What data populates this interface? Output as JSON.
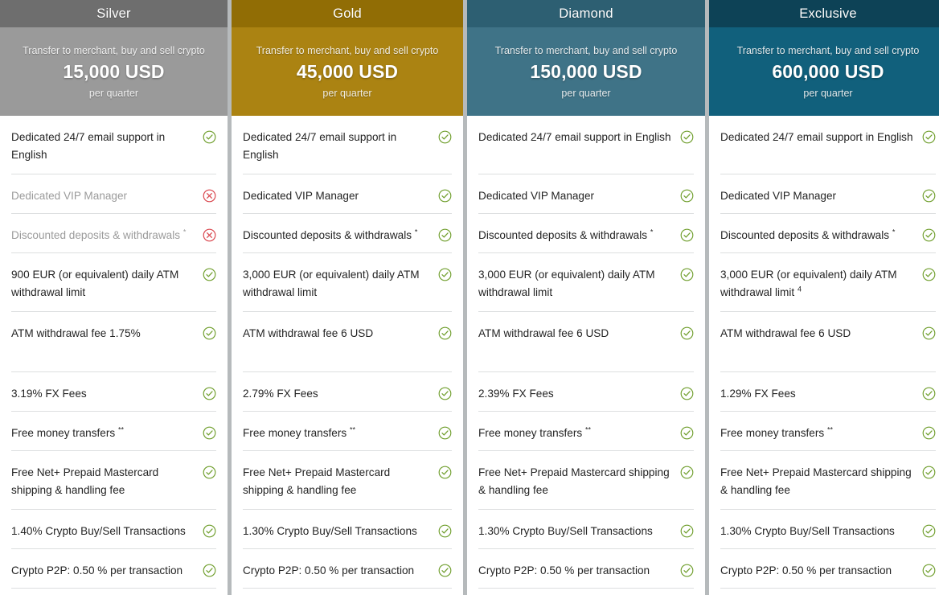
{
  "comparison_table": {
    "price_caption": "Transfer to merchant, buy and sell crypto",
    "price_period": "per quarter",
    "icons": {
      "included": "check-circle-icon",
      "excluded": "x-circle-icon"
    },
    "colors": {
      "silver_header": "#6e6e6e",
      "silver_body": "#9a9a9a",
      "gold_header": "#916d05",
      "gold_body": "#ab8312",
      "diamond_header": "#2d5f72",
      "diamond_body": "#3f7387",
      "exclusive_header": "#0d4256",
      "exclusive_body": "#11607c",
      "check_green": "#6f9e2c",
      "cross_red": "#d9434b",
      "row_divider": "#dddfe0",
      "column_gap": "#b6babc"
    },
    "tiers": [
      {
        "name": "Silver",
        "price": "15,000 USD",
        "features": [
          {
            "text": "Dedicated 24/7 email support in English",
            "sup": "",
            "included": true,
            "size": "tall"
          },
          {
            "text": "Dedicated VIP Manager",
            "sup": "",
            "included": false,
            "size": "normal"
          },
          {
            "text": "Discounted deposits & withdrawals",
            "sup": "*",
            "included": false,
            "size": "normal"
          },
          {
            "text": "900 EUR (or equivalent) daily ATM withdrawal limit",
            "sup": "",
            "included": true,
            "size": "tall"
          },
          {
            "text": "ATM withdrawal fee 1.75%",
            "sup": "",
            "included": true,
            "size": "xtall"
          },
          {
            "text": "3.19% FX Fees",
            "sup": "",
            "included": true,
            "size": "normal"
          },
          {
            "text": "Free money transfers",
            "sup": "**",
            "included": true,
            "size": "normal"
          },
          {
            "text": "Free Net+ Prepaid Mastercard shipping & handling fee",
            "sup": "",
            "included": true,
            "size": "tall"
          },
          {
            "text": "1.40% Crypto Buy/Sell Transactions",
            "sup": "",
            "included": true,
            "size": "normal"
          },
          {
            "text": "Crypto P2P: 0.50 % per transaction",
            "sup": "",
            "included": true,
            "size": "normal"
          }
        ]
      },
      {
        "name": "Gold",
        "price": "45,000 USD",
        "features": [
          {
            "text": "Dedicated 24/7 email support in English",
            "sup": "",
            "included": true,
            "size": "tall"
          },
          {
            "text": "Dedicated VIP Manager",
            "sup": "",
            "included": true,
            "size": "normal"
          },
          {
            "text": "Discounted deposits & withdrawals",
            "sup": "*",
            "included": true,
            "size": "normal"
          },
          {
            "text": "3,000 EUR (or equivalent) daily ATM withdrawal limit",
            "sup": "",
            "included": true,
            "size": "tall"
          },
          {
            "text": "ATM withdrawal fee 6 USD",
            "sup": "",
            "included": true,
            "size": "xtall"
          },
          {
            "text": "2.79% FX Fees",
            "sup": "",
            "included": true,
            "size": "normal"
          },
          {
            "text": "Free money transfers",
            "sup": "**",
            "included": true,
            "size": "normal"
          },
          {
            "text": "Free Net+ Prepaid Mastercard shipping & handling fee",
            "sup": "",
            "included": true,
            "size": "tall"
          },
          {
            "text": "1.30% Crypto Buy/Sell Transactions",
            "sup": "",
            "included": true,
            "size": "normal"
          },
          {
            "text": "Crypto P2P: 0.50 % per transaction",
            "sup": "",
            "included": true,
            "size": "normal"
          }
        ]
      },
      {
        "name": "Diamond",
        "price": "150,000 USD",
        "features": [
          {
            "text": "Dedicated 24/7 email support in English",
            "sup": "",
            "included": true,
            "size": "tall"
          },
          {
            "text": "Dedicated VIP Manager",
            "sup": "",
            "included": true,
            "size": "normal"
          },
          {
            "text": "Discounted deposits & withdrawals",
            "sup": "*",
            "included": true,
            "size": "normal"
          },
          {
            "text": "3,000 EUR (or equivalent) daily ATM withdrawal limit",
            "sup": "",
            "included": true,
            "size": "tall"
          },
          {
            "text": "ATM withdrawal fee 6 USD",
            "sup": "",
            "included": true,
            "size": "xtall"
          },
          {
            "text": "2.39% FX Fees",
            "sup": "",
            "included": true,
            "size": "normal"
          },
          {
            "text": "Free money transfers",
            "sup": "**",
            "included": true,
            "size": "normal"
          },
          {
            "text": "Free Net+ Prepaid Mastercard shipping & handling fee",
            "sup": "",
            "included": true,
            "size": "tall"
          },
          {
            "text": "1.30% Crypto Buy/Sell Transactions",
            "sup": "",
            "included": true,
            "size": "normal"
          },
          {
            "text": "Crypto P2P: 0.50 % per transaction",
            "sup": "",
            "included": true,
            "size": "normal"
          }
        ]
      },
      {
        "name": "Exclusive",
        "price": "600,000 USD",
        "features": [
          {
            "text": "Dedicated 24/7 email support in English",
            "sup": "",
            "included": true,
            "size": "tall"
          },
          {
            "text": "Dedicated VIP Manager",
            "sup": "",
            "included": true,
            "size": "normal"
          },
          {
            "text": "Discounted deposits & withdrawals",
            "sup": "*",
            "included": true,
            "size": "normal"
          },
          {
            "text": "3,000 EUR (or equivalent) daily ATM withdrawal limit",
            "sup": "4",
            "included": true,
            "size": "tall"
          },
          {
            "text": "ATM withdrawal fee 6 USD",
            "sup": "",
            "included": true,
            "size": "xtall"
          },
          {
            "text": "1.29% FX Fees",
            "sup": "",
            "included": true,
            "size": "normal"
          },
          {
            "text": "Free money transfers",
            "sup": "**",
            "included": true,
            "size": "normal"
          },
          {
            "text": "Free Net+ Prepaid Mastercard shipping & handling fee",
            "sup": "",
            "included": true,
            "size": "tall"
          },
          {
            "text": "1.30% Crypto Buy/Sell Transactions",
            "sup": "",
            "included": true,
            "size": "normal"
          },
          {
            "text": "Crypto P2P: 0.50 % per transaction",
            "sup": "",
            "included": true,
            "size": "normal"
          }
        ]
      }
    ]
  }
}
